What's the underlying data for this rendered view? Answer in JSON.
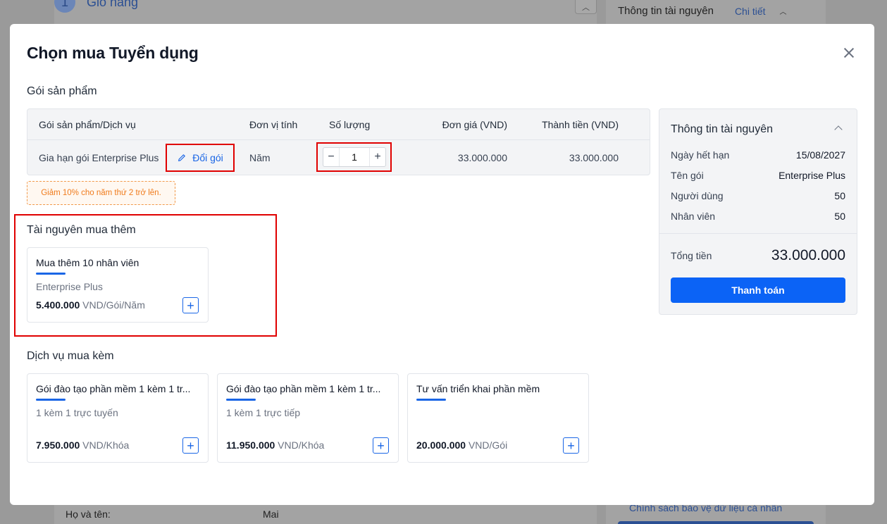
{
  "background": {
    "step_number": "1",
    "step_title": "Giỏ hàng",
    "collapse_icon": "chevron-up-icon",
    "resource_title": "Thông tin tài nguyên",
    "resource_detail": "Chi tiết",
    "name_label": "Họ và tên:",
    "name_value": "Mai",
    "policy_link": "Chính sách bảo vệ dữ liệu cá nhân"
  },
  "modal": {
    "title": "Chọn mua Tuyển dụng",
    "close_icon": "close-icon"
  },
  "product_section": {
    "title": "Gói sản phẩm",
    "columns": {
      "product": "Gói sản phẩm/Dịch vụ",
      "unit": "Đơn vị tính",
      "quantity": "Số lượng",
      "unit_price": "Đơn giá (VND)",
      "total": "Thành tiền (VND)"
    },
    "row": {
      "product": "Gia hạn gói Enterprise Plus",
      "change_label": "Đổi gói",
      "unit": "Năm",
      "quantity": "1",
      "minus": "−",
      "plus": "+",
      "unit_price": "33.000.000",
      "total": "33.000.000"
    },
    "discount_note": "Giảm 10% cho năm thứ 2 trở lên."
  },
  "extra_resources": {
    "title": "Tài nguyên mua thêm",
    "items": [
      {
        "title": "Mua thêm 10 nhân viên",
        "subtitle": "Enterprise Plus",
        "price": "5.400.000",
        "unit": " VND/Gói/Năm",
        "add": "+"
      }
    ]
  },
  "services": {
    "title": "Dịch vụ mua kèm",
    "items": [
      {
        "title": "Gói đào tạo phần mềm 1 kèm 1 tr...",
        "subtitle": "1 kèm 1 trực tuyến",
        "price": "7.950.000",
        "unit": " VND/Khóa",
        "add": "+"
      },
      {
        "title": "Gói đào tạo phần mềm 1 kèm 1 tr...",
        "subtitle": "1 kèm 1 trực tiếp",
        "price": "11.950.000",
        "unit": " VND/Khóa",
        "add": "+"
      },
      {
        "title": "Tư vấn triển khai phần mềm",
        "subtitle": "",
        "price": "20.000.000",
        "unit": " VND/Gói",
        "add": "+"
      }
    ]
  },
  "resource_panel": {
    "title": "Thông tin tài nguyên",
    "rows": [
      {
        "label": "Ngày hết hạn",
        "value": "15/08/2027"
      },
      {
        "label": "Tên gói",
        "value": "Enterprise Plus"
      },
      {
        "label": "Người dùng",
        "value": "50"
      },
      {
        "label": "Nhân viên",
        "value": "50"
      }
    ],
    "total_label": "Tổng tiền",
    "total_value": "33.000.000",
    "pay_button": "Thanh toán"
  },
  "colors": {
    "primary": "#0b63f6",
    "link": "#1a66e6",
    "highlight_border": "#e00000",
    "discount": "#f07b1c"
  }
}
